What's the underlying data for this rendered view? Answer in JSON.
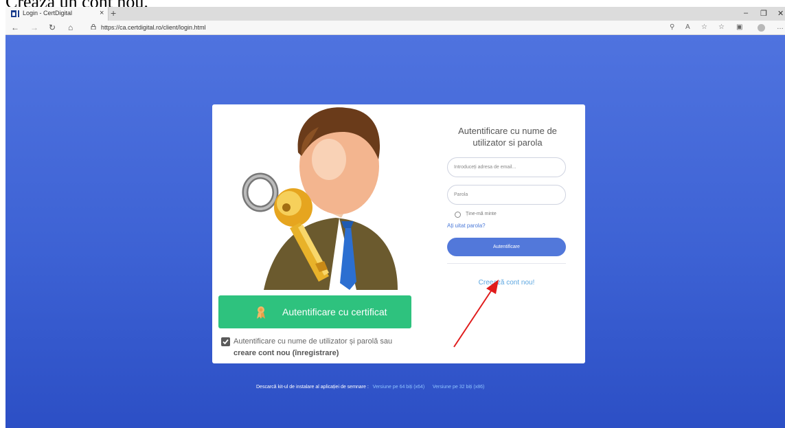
{
  "document": {
    "title_fragment": "Crează un cont nou."
  },
  "browser": {
    "tab_title": "Login - CertDigital",
    "tab_close": "×",
    "new_tab": "+",
    "minimize": "–",
    "restore": "❐",
    "close": "✕",
    "back": "←",
    "forward": "→",
    "refresh": "↻",
    "home": "⌂",
    "url": "https://ca.certdigital.ro/client/login.html",
    "more": "…"
  },
  "login": {
    "title": "Autentificare cu nume de utilizator si parola",
    "email_placeholder": "Introduceți adresa de email...",
    "password_placeholder": "Parola",
    "remember": "Ține-mă minte",
    "forgot": "Ați uitat parola?",
    "submit": "Autentificare",
    "create": "Creează cont nou!"
  },
  "certificate": {
    "button": "Autentificare cu certificat",
    "check_text": "Autentificare cu nume de utilizator și parolă sau",
    "check_bold": "creare cont nou (înregistrare)"
  },
  "footer": {
    "text": "Descarcă kit-ul de instalare al aplicației de semnare :",
    "link64": "Versiune pe 64 biți (x64)",
    "link32": "Versiune pe 32 biți (x86)"
  },
  "colors": {
    "accent": "#5278da",
    "green": "#2ec27e",
    "link": "#5ba6e0",
    "arrow": "#e01b1b"
  }
}
